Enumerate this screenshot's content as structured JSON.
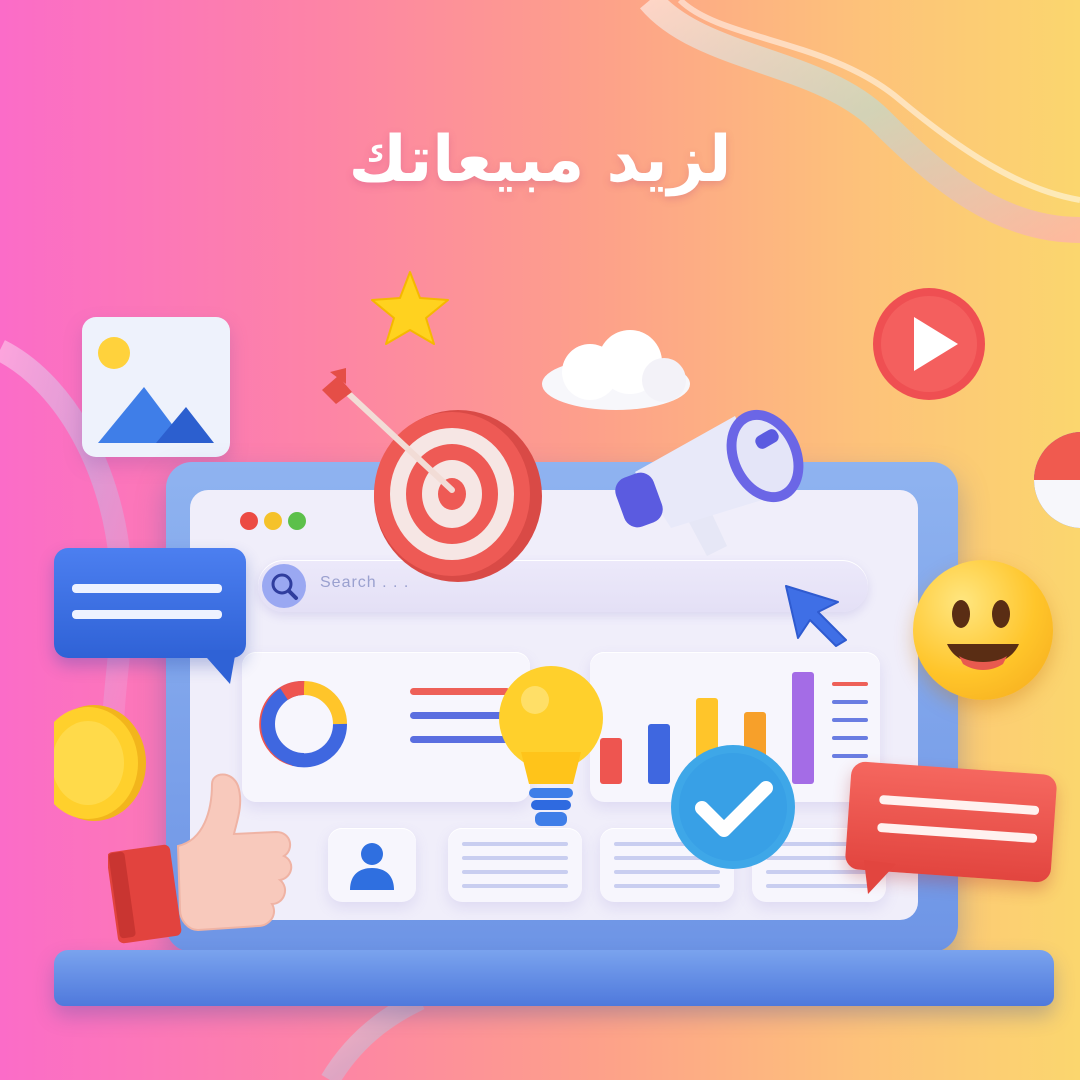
{
  "headline": "لزيد مبيعاتك",
  "search": {
    "placeholder": "Search . . ."
  },
  "colors": {
    "background_left": "#fb6cc8",
    "background_right": "#fbd66e",
    "laptop_frame": "#7ea5ec",
    "screen": "#f0eefa",
    "accent_blue": "#3f67e0",
    "accent_red": "#ee5550",
    "accent_yellow": "#ffc52a",
    "accent_purple": "#a46ce6"
  },
  "icons": {
    "image": "image-icon",
    "star": "star-icon",
    "cloud": "cloud-icon",
    "play": "play-icon",
    "target": "target-icon",
    "megaphone": "megaphone-icon",
    "cursor": "cursor-icon",
    "lightbulb": "lightbulb-icon",
    "check": "check-icon",
    "thumbs_up": "thumbs-up-icon",
    "user": "user-icon",
    "smiley": "smiley-icon",
    "coin": "coin-icon",
    "donut_chart": "donut-chart-icon",
    "bar_chart": "bar-chart-icon",
    "search": "search-icon"
  }
}
